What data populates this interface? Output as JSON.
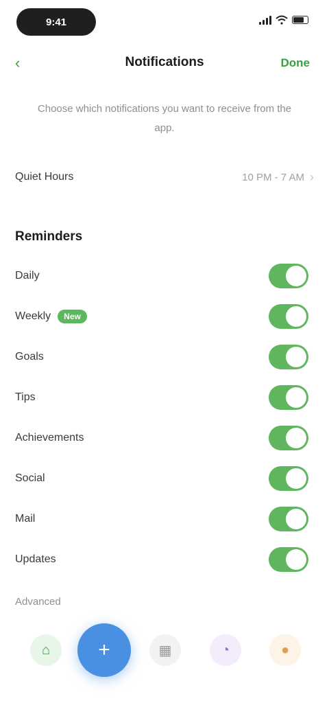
{
  "status_bar": {
    "time": "9:41"
  },
  "nav": {
    "back_icon": "chevron-left-icon",
    "title": "Notifications",
    "action_label": "Done"
  },
  "description": "Choose which notifications you want to receive from the app.",
  "setting": {
    "label": "Quiet Hours",
    "value": "10 PM - 7 AM"
  },
  "section": {
    "title": "Reminders"
  },
  "items": [
    {
      "label": "Daily",
      "badge": "",
      "enabled": true
    },
    {
      "label": "Weekly",
      "badge": "New",
      "enabled": true
    },
    {
      "label": "Goals",
      "badge": "",
      "enabled": true
    },
    {
      "label": "Tips",
      "badge": "",
      "enabled": true
    },
    {
      "label": "Achievements",
      "badge": "",
      "enabled": true
    },
    {
      "label": "Social",
      "badge": "",
      "enabled": true
    },
    {
      "label": "Mail",
      "badge": "",
      "enabled": true
    },
    {
      "label": "Updates",
      "badge": "",
      "enabled": true
    }
  ],
  "more_label": "Advanced",
  "dock": {
    "primary_icon": "plus-icon",
    "icons": [
      "home-icon",
      "calendar-icon",
      "chart-icon",
      "profile-icon"
    ]
  },
  "colors": {
    "accent_green": "#5fb65f",
    "primary_blue": "#4a90e2"
  }
}
